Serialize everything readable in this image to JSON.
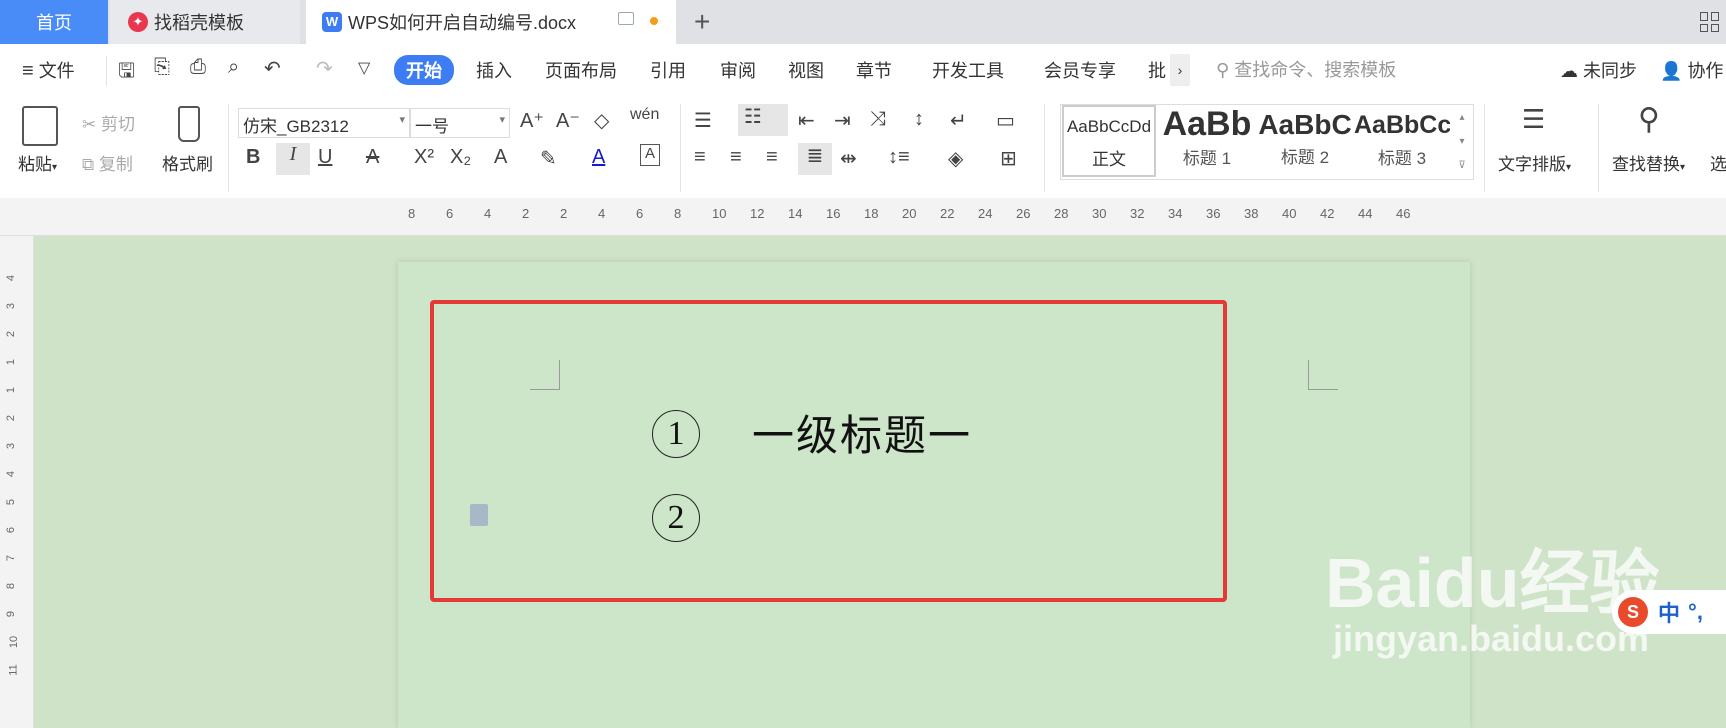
{
  "tabs": {
    "home": "首页",
    "template": "找稻壳模板",
    "doc": "WPS如何开启自动编号.docx"
  },
  "menubar": {
    "file": "文件",
    "items": [
      "开始",
      "插入",
      "页面布局",
      "引用",
      "审阅",
      "视图",
      "章节",
      "开发工具",
      "会员专享",
      "批"
    ],
    "search_placeholder": "查找命令、搜索模板",
    "sync": "未同步",
    "collab": "协作"
  },
  "ribbon": {
    "paste": "粘贴",
    "cut": "剪切",
    "copy": "复制",
    "format_painter": "格式刷",
    "font_name": "仿宋_GB2312",
    "font_size": "一号",
    "pinyin": "wén",
    "styles": [
      {
        "preview": "AaBbCcDd",
        "name": "正文"
      },
      {
        "preview": "AaBb",
        "name": "标题 1"
      },
      {
        "preview": "AaBbC",
        "name": "标题 2"
      },
      {
        "preview": "AaBbCc",
        "name": "标题 3"
      }
    ],
    "text_layout": "文字排版",
    "find_replace": "查找替换",
    "select": "选"
  },
  "ruler": {
    "h_ticks": [
      "8",
      "6",
      "4",
      "2",
      "2",
      "4",
      "6",
      "8",
      "10",
      "12",
      "14",
      "16",
      "18",
      "20",
      "22",
      "24",
      "26",
      "28",
      "30",
      "32",
      "34",
      "36",
      "38",
      "40",
      "42",
      "44",
      "46"
    ],
    "v_ticks": [
      "4",
      "3",
      "2",
      "1",
      "1",
      "2",
      "3",
      "4",
      "5",
      "6",
      "7",
      "8",
      "9",
      "10",
      "11"
    ]
  },
  "document": {
    "num1": "1",
    "heading1": "一级标题一",
    "num2": "2"
  },
  "watermark": {
    "logo": "Baidu经验",
    "url": "jingyan.baidu.com"
  },
  "ime": {
    "label": "中",
    "punct": "°,"
  },
  "colors": {
    "accent": "#3d7cf2",
    "highlight_border": "#e53935",
    "page_bg": "#cde5c9"
  }
}
